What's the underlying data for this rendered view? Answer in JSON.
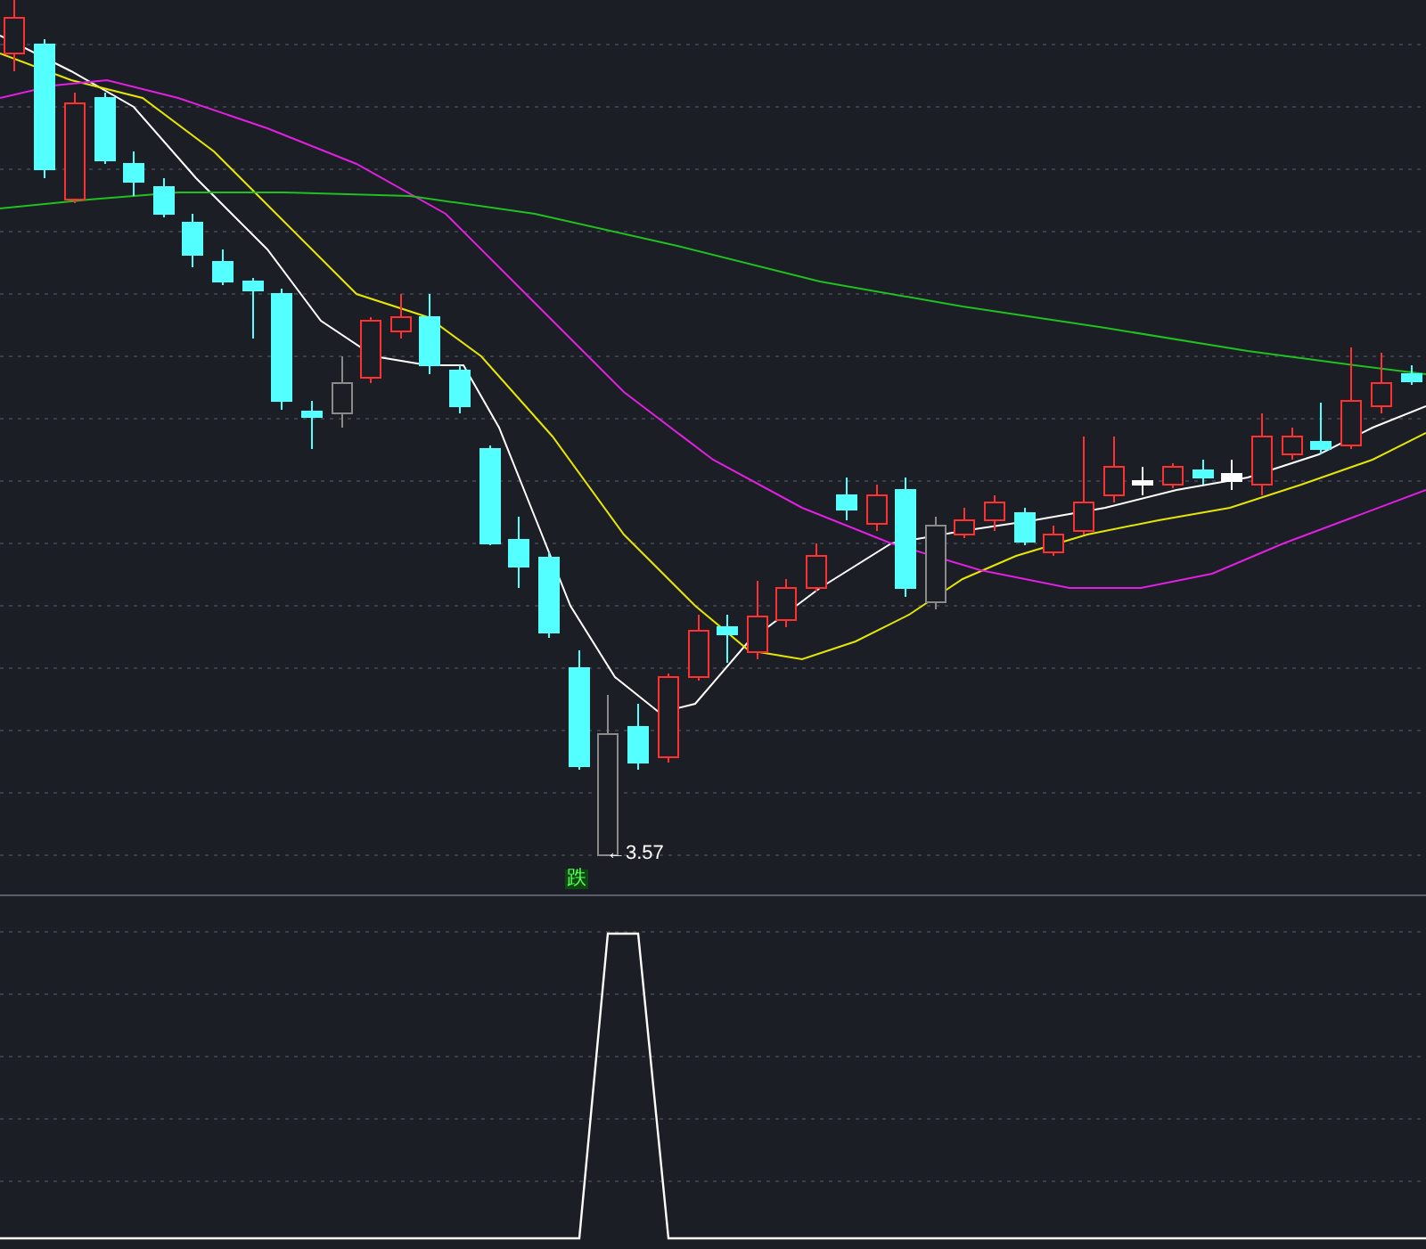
{
  "price_chart": {
    "low_marker": "←3.57",
    "signal_label": "跌"
  }
}
